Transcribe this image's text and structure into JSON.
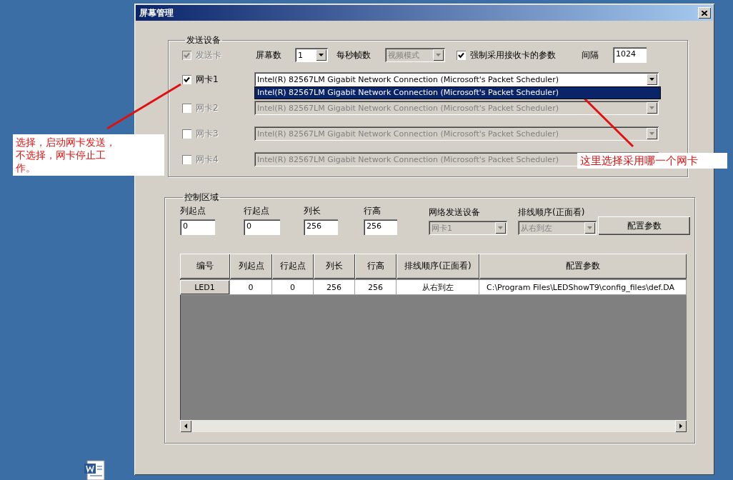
{
  "window": {
    "title": "屏幕管理"
  },
  "send_devices": {
    "label": "发送设备",
    "send_card": {
      "label": "发送卡",
      "checked": true,
      "disabled": true
    },
    "screen_count": {
      "label": "屏幕数",
      "value": "1",
      "disabled": false
    },
    "fps": {
      "label": "每秒帧数",
      "value": "视频模式",
      "disabled": true
    },
    "force_receiver": {
      "label": "强制采用接收卡的参数",
      "checked": true
    },
    "interval": {
      "label": "间隔",
      "value": "1024"
    },
    "cards": [
      {
        "label": "网卡1",
        "checked": true,
        "adapter": "Intel(R) 82567LM Gigabit Network Connection (Microsoft's Packet Scheduler)",
        "disabled": false,
        "expanded": true,
        "options": [
          {
            "label": "Intel(R) 82567LM Gigabit Network Connection (Microsoft's Packet Scheduler)",
            "selected": true
          }
        ]
      },
      {
        "label": "网卡2",
        "checked": false,
        "adapter": "Intel(R) 82567LM Gigabit Network Connection (Microsoft's Packet Scheduler)",
        "disabled": true,
        "expanded": false
      },
      {
        "label": "网卡3",
        "checked": false,
        "adapter": "Intel(R) 82567LM Gigabit Network Connection (Microsoft's Packet Scheduler)",
        "disabled": true,
        "expanded": false
      },
      {
        "label": "网卡4",
        "checked": false,
        "adapter": "Intel(R) 82567LM Gigabit Network Connection (Microsoft's Packet Scheduler)",
        "disabled": true,
        "expanded": false
      }
    ]
  },
  "control_area": {
    "label": "控制区域",
    "fields": [
      {
        "label": "列起点",
        "value": "0"
      },
      {
        "label": "行起点",
        "value": "0"
      },
      {
        "label": "列长",
        "value": "256"
      },
      {
        "label": "行高",
        "value": "256"
      }
    ],
    "combos": [
      {
        "label": "网络发送设备",
        "value": "网卡1",
        "disabled": true
      },
      {
        "label": "排线顺序(正面看)",
        "value": "从右到左",
        "disabled": true
      }
    ],
    "button": "配置参数",
    "table": {
      "columns": [
        "编号",
        "列起点",
        "行起点",
        "列长",
        "行高",
        "排线顺序(正面看)",
        "配置参数"
      ],
      "rows": [
        {
          "cells": [
            "LED1",
            "0",
            "0",
            "256",
            "256",
            "从右到左",
            "C:\\Program Files\\LEDShowT9\\config_files\\def.DA"
          ]
        }
      ]
    }
  },
  "annotations": [
    {
      "text": "选择，启动网卡发送，不选择，网卡停止工作。"
    },
    {
      "text": "这里选择采用哪一个网卡"
    }
  ]
}
